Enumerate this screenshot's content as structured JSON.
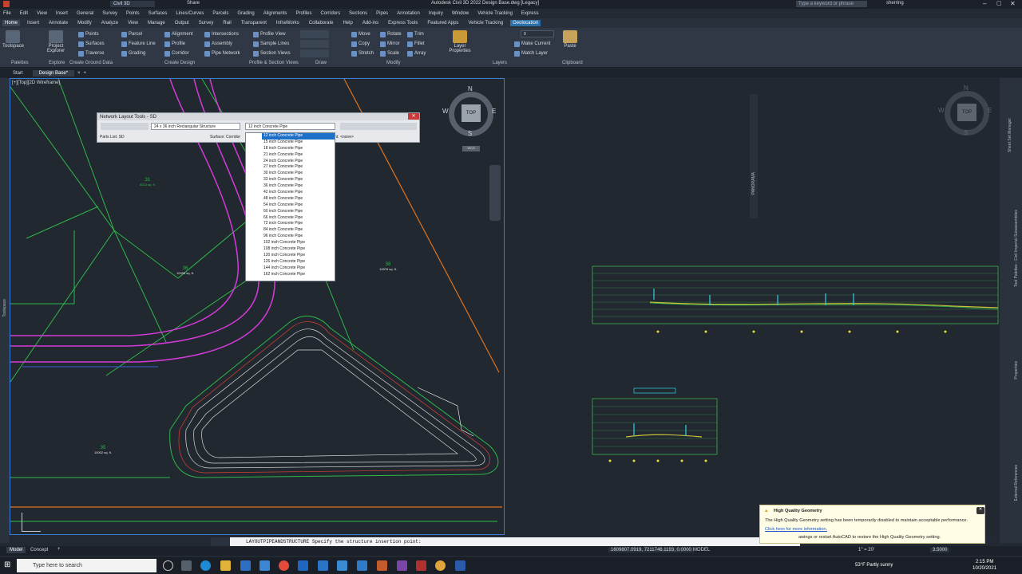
{
  "app": {
    "title": "Autodesk Civil 3D 2022   Design Base.dwg [Legacy]",
    "workspace": "Civil 3D",
    "share": "Share",
    "search_placeholder": "Type a keyword or phrase",
    "user": "sherring"
  },
  "menu": [
    "File",
    "Edit",
    "View",
    "Insert",
    "General",
    "Survey",
    "Points",
    "Surfaces",
    "Lines/Curves",
    "Parcels",
    "Grading",
    "Alignments",
    "Profiles",
    "Corridors",
    "Sections",
    "Pipes",
    "Annotation",
    "Inquiry",
    "Window",
    "Vehicle Tracking",
    "Express"
  ],
  "ribbon_tabs": [
    "Home",
    "Insert",
    "Annotate",
    "Modify",
    "Analyze",
    "View",
    "Manage",
    "Output",
    "Survey",
    "Rail",
    "Transparent",
    "InfraWorks",
    "Collaborate",
    "Help",
    "Add-ins",
    "Express Tools",
    "Featured Apps",
    "Vehicle Tracking",
    "Geolocation"
  ],
  "ribbon": {
    "toolspace": "Toolspace",
    "project_explorer": "Project Explorer",
    "palettes": "Palettes",
    "explore": "Explore",
    "create_ground_data": "Create Ground Data",
    "points": "Points",
    "surfaces": "Surfaces",
    "traverse": "Traverse",
    "parcel": "Parcel",
    "feature_line": "Feature Line",
    "grading": "Grading",
    "alignment": "Alignment",
    "profile": "Profile",
    "corridor": "Corridor",
    "create_design": "Create Design",
    "intersections": "Intersections",
    "assembly": "Assembly",
    "pipe_network": "Pipe Network",
    "profile_view": "Profile View",
    "sample_lines": "Sample Lines",
    "section_views": "Section Views",
    "profile_section_views": "Profile & Section Views",
    "draw": "Draw",
    "move": "Move",
    "copy": "Copy",
    "stretch": "Stretch",
    "rotate": "Rotate",
    "mirror": "Mirror",
    "scale": "Scale",
    "trim": "Trim",
    "fillet": "Fillet",
    "array": "Array",
    "modify": "Modify",
    "layer_properties": "Layer Properties",
    "layer_value": "0",
    "make_current": "Make Current",
    "match_layer": "Match Layer",
    "layers": "Layers",
    "paste": "Paste",
    "clipboard": "Clipboard"
  },
  "doc_tabs": [
    "Start",
    "Design Base*"
  ],
  "viewport_label": "[+][Top][2D Wireframe]",
  "toolspace_label": "Toolspace",
  "panorama_label": "PANORAMA",
  "compass": {
    "n": "N",
    "s": "S",
    "e": "E",
    "w": "W",
    "top": "TOP",
    "wcs": "WCS"
  },
  "network_tools": {
    "title": "Network Layout Tools - SD",
    "structure": "24 x 36 inch Rectangular Structure",
    "pipe": "12 inch Concrete Pipe",
    "parts_list": "Parts List: SD",
    "surface": "Surface: Corridor",
    "alignment": "nt: <none>"
  },
  "pipe_sizes": [
    "12 inch Concrete Pipe",
    "15 inch Concrete Pipe",
    "18 inch Concrete Pipe",
    "21 inch Concrete Pipe",
    "24 inch Concrete Pipe",
    "27 inch Concrete Pipe",
    "30 inch Concrete Pipe",
    "33 inch Concrete Pipe",
    "36 inch Concrete Pipe",
    "42 inch Concrete Pipe",
    "48 inch Concrete Pipe",
    "54 inch Concrete Pipe",
    "60 inch Concrete Pipe",
    "66 inch Concrete Pipe",
    "72 inch Concrete Pipe",
    "84 inch Concrete Pipe",
    "96 inch Concrete Pipe",
    "102 inch Concrete Pipe",
    "108 inch Concrete Pipe",
    "120 inch Concrete Pipe",
    "126 inch Concrete Pipe",
    "144 inch Concrete Pipe",
    "162 inch Concrete Pipe"
  ],
  "parcels": [
    {
      "num": "31",
      "area": "8013 sq. ft."
    },
    {
      "num": "36",
      "area": "10093 sq. ft."
    },
    {
      "num": "38",
      "area": "12678 sq. ft."
    },
    {
      "num": "35",
      "area": "10002 sq. ft."
    }
  ],
  "command_line": "LAYOUTPIPEANDSTRUCTURE Specify the structure insertion point:",
  "status": {
    "model_tab": "Model",
    "layout_tab": "Concept",
    "coords": "1609807.0919, 7211746.1193, 0.0000",
    "model": "MODEL",
    "scale": "1\" = 20'",
    "value": "3.5000"
  },
  "notification": {
    "title": "High Quality Geometry",
    "body": "The High Quality Geometry setting has been temporarily disabled to maintain acceptable performance.",
    "link": "Click here for more information.",
    "body2": "awings or restart AutoCAD to restore the High Quality Geometry setting."
  },
  "right_palettes": [
    "Sheet Set Manager",
    "Tool Palettes - Civil Imperial Subassemblies",
    "Properties",
    "External References"
  ],
  "taskbar": {
    "search": "Type here to search",
    "weather": "53°F  Partly sunny",
    "time": "2:15 PM",
    "date": "10/20/2021"
  },
  "colors": {
    "accent": "#2c6ea6",
    "highlight": "#1e6fc8",
    "parcel_line": "#2fb84a",
    "road": "#d43ad9",
    "property": "#e0731e"
  }
}
